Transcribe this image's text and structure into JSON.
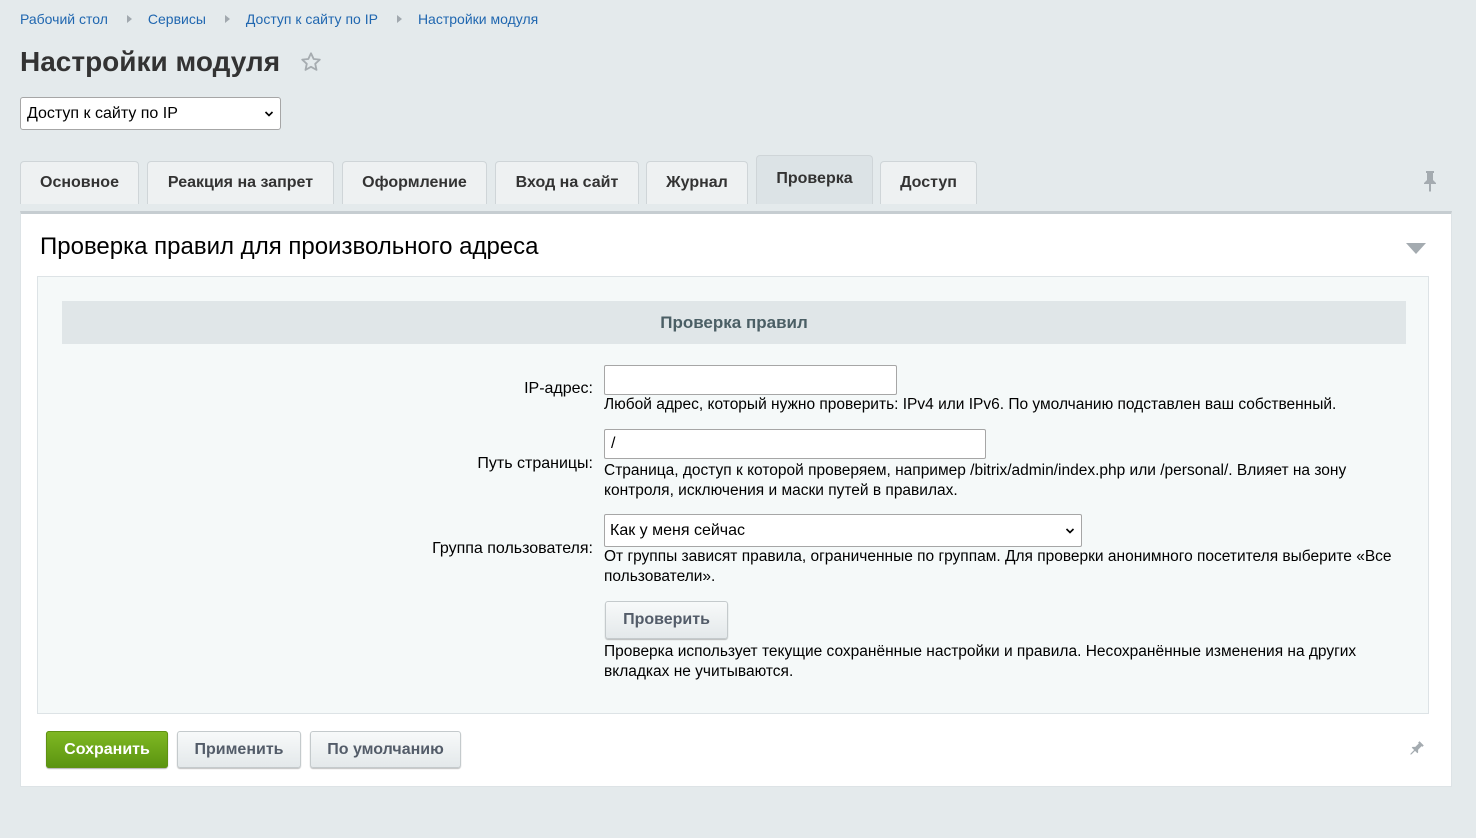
{
  "breadcrumb": [
    "Рабочий стол",
    "Сервисы",
    "Доступ к сайту по IP",
    "Настройки модуля"
  ],
  "page": {
    "title": "Настройки модуля"
  },
  "module_select": {
    "value": "Доступ к сайту по IP"
  },
  "tabs": [
    "Основное",
    "Реакция на запрет",
    "Оформление",
    "Вход на сайт",
    "Журнал",
    "Проверка",
    "Доступ"
  ],
  "active_tab": "Проверка",
  "section": {
    "title": "Проверка правил для произвольного адреса",
    "subheader": "Проверка правил"
  },
  "form": {
    "ip": {
      "label": "IP-адрес:",
      "value": "",
      "hint": "Любой адрес, который нужно проверить: IPv4 или IPv6. По умолчанию подставлен ваш собственный."
    },
    "path": {
      "label": "Путь страницы:",
      "value": "/",
      "hint": "Страница, доступ к которой проверяем, например /bitrix/admin/index.php или /personal/. Влияет на зону контроля, исключения и маски путей в правилах."
    },
    "group": {
      "label": "Группа пользователя:",
      "value": "Как у меня сейчас",
      "hint": "От группы зависят правила, ограниченные по группам. Для проверки анонимного посетителя выберите «Все пользователи»."
    },
    "check_button": "Проверить",
    "check_hint": "Проверка использует текущие сохранённые настройки и правила. Несохранённые изменения на других вкладках не учитываются."
  },
  "footer": {
    "save": "Сохранить",
    "apply": "Применить",
    "default": "По умолчанию"
  },
  "colors": {
    "link": "#2067b0",
    "background": "#e4eaec",
    "save_button": "#6ba419",
    "panel_header": "#e0e6e8"
  },
  "icons": [
    "star-icon",
    "chevron-down-icon",
    "pin-icon",
    "collapse-triangle-icon"
  ]
}
